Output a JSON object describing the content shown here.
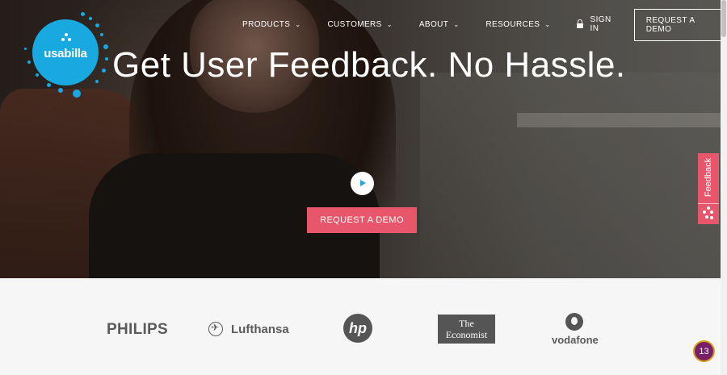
{
  "brand": {
    "name": "usabilla",
    "color": "#19a9e1"
  },
  "nav": {
    "items": [
      {
        "label": "PRODUCTS"
      },
      {
        "label": "CUSTOMERS"
      },
      {
        "label": "ABOUT"
      },
      {
        "label": "RESOURCES"
      }
    ],
    "sign_in": "SIGN IN",
    "demo_button": "REQUEST A DEMO"
  },
  "hero": {
    "headline": "Get User Feedback. No Hassle.",
    "cta": "REQUEST A DEMO",
    "cta_color": "#e8566b"
  },
  "feedback_tab": {
    "label": "Feedback",
    "color": "#e8566b"
  },
  "clients": {
    "philips": "PHILIPS",
    "lufthansa": "Lufthansa",
    "hp": "hp",
    "economist_line1": "The",
    "economist_line2": "Economist",
    "vodafone": "vodafone"
  },
  "notification": {
    "count": "13"
  }
}
